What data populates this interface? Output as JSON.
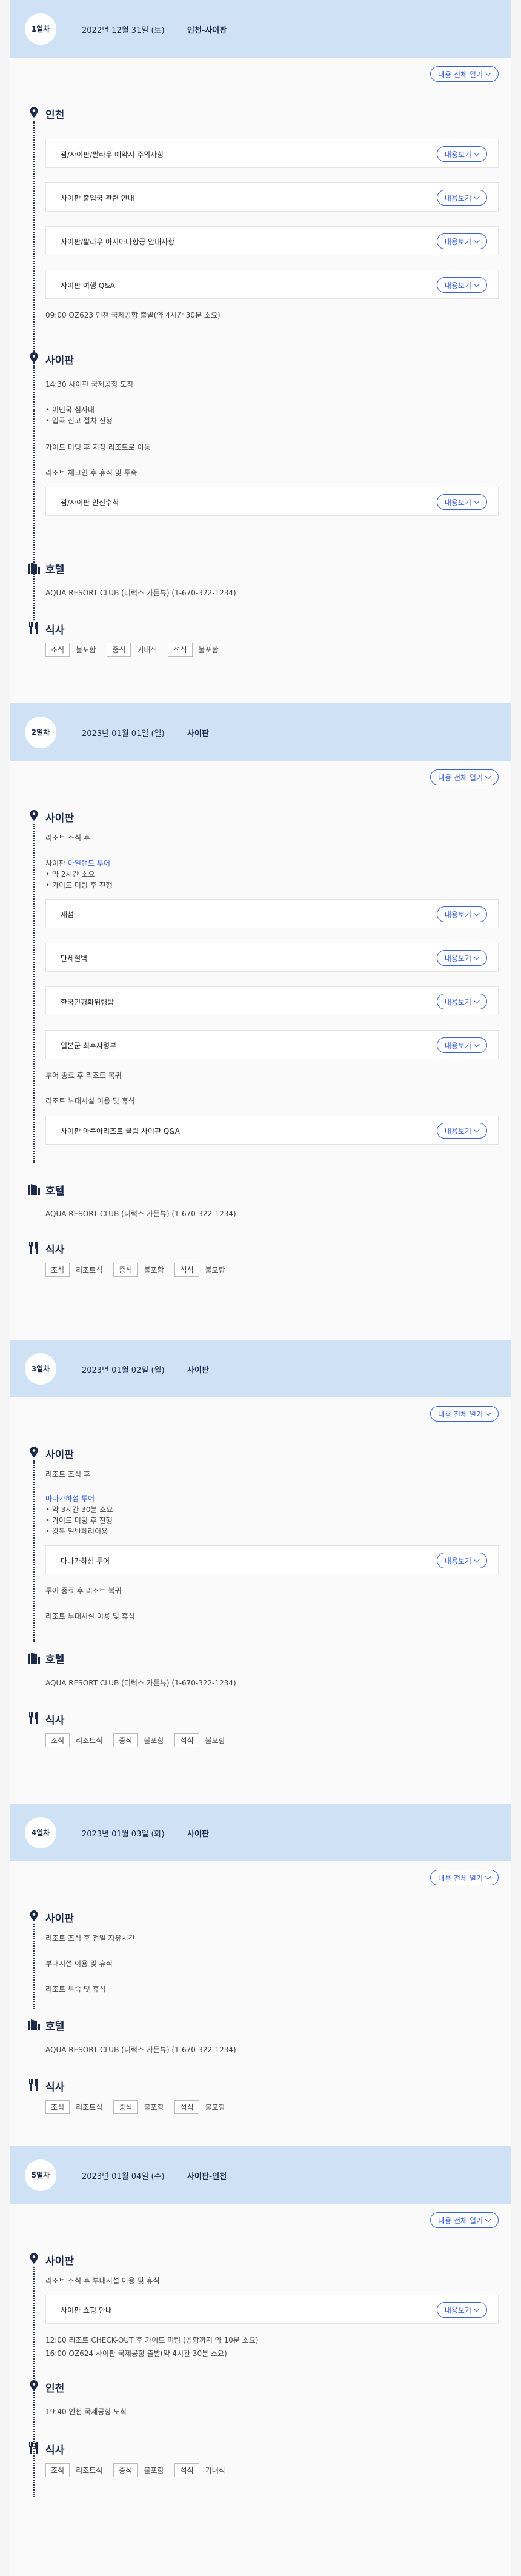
{
  "expand_all_label": "내용 전체 열기",
  "more_label": "내용보기",
  "hotel_label": "호텔",
  "meal_label": "식사",
  "meal_names": {
    "breakfast": "조식",
    "lunch": "중식",
    "dinner": "석식"
  },
  "days": [
    {
      "badge": "1일차",
      "date": "2022년 12월 31일 (토)",
      "route": "인천-사이판",
      "incheon": "인천",
      "cards1": [
        "괌/사이판/팔라우 예약시 주의사항",
        "사이판 출입국 관련 안내",
        "사이판/팔라우 아시아나항공 안내사항",
        "사이판 여행 Q&A"
      ],
      "depart": "09:00 OZ623 인천 국제공항 출발(약 4시간 30분 소요)",
      "saipan": "사이판",
      "arrive": "14:30 사이판 국제공항 도착",
      "immig1": "• 이민국 심사대",
      "immig2": "• 입국 신고 절차 진행",
      "guide": "가이드 미팅 후 지정 리조트로 이동",
      "checkin": "리조트 체크인 후 휴식 및 투숙",
      "safety": "괌/사이판 안전수칙",
      "hotel": "AQUA RESORT CLUB (디럭스 가든뷰) (1-670-322-1234)",
      "breakfast": "불포함",
      "lunch": "기내식",
      "dinner": "불포함"
    },
    {
      "badge": "2일차",
      "date": "2023년 01월 01일 (일)",
      "route": "사이판",
      "saipan": "사이판",
      "after_breakfast": "리조트 조식 후",
      "tour_prefix": "사이판 ",
      "tour_link": "아일랜드 투어",
      "tour1": "• 약 2시간 소요",
      "tour2": "• 가이드 미팅 후 진행",
      "cards": [
        "새섬",
        "만세절벽",
        "한국인평화위령탑",
        "일본군 최후사령부"
      ],
      "back": "투어 종료 후 리조트 복귀",
      "facilities": "리조트 부대시설 이용 및 휴식",
      "qa_card": "사이판 아쿠아리조트 클럽 사이판 Q&A",
      "hotel": "AQUA RESORT CLUB (디럭스 가든뷰) (1-670-322-1234)",
      "breakfast": "리조트식",
      "lunch": "불포함",
      "dinner": "불포함"
    },
    {
      "badge": "3일차",
      "date": "2023년 01월 02일 (월)",
      "route": "사이판",
      "saipan": "사이판",
      "after_breakfast": "리조트 조식 후",
      "tour_link": "마나가하섬 투어",
      "tour1": "• 약 3시간 30분 소요",
      "tour2": "• 가이드 미팅 후 진행",
      "tour3": "• 왕복 일반페리이용",
      "card": "마나가하섬 투어",
      "back": "투어 종료 후 리조트 복귀",
      "facilities": "리조트 부대시설 이용 및 휴식",
      "hotel": "AQUA RESORT CLUB (디럭스 가든뷰) (1-670-322-1234)",
      "breakfast": "리조트식",
      "lunch": "불포함",
      "dinner": "불포함"
    },
    {
      "badge": "4일차",
      "date": "2023년 01월 03일 (화)",
      "route": "사이판",
      "saipan": "사이판",
      "line1": "리조트 조식 후 전일 자유시간",
      "line2": "부대시설 이용 및 휴식",
      "line3": "리조트 투숙 및 휴식",
      "hotel": "AQUA RESORT CLUB (디럭스 가든뷰) (1-670-322-1234)",
      "breakfast": "리조트식",
      "lunch": "불포함",
      "dinner": "불포함"
    },
    {
      "badge": "5일차",
      "date": "2023년 01월 04일 (수)",
      "route": "사이판-인천",
      "saipan": "사이판",
      "line1": "리조트 조식 후 부대시설 이용 및 휴식",
      "card": "사이판 쇼핑 안내",
      "checkout": "12:00 리조트 CHECK-OUT 후 가이드 미팅 (공항까지 약 10분 소요)",
      "depart": "16:00 OZ624 사이판 국제공항 출발(약 4시간 30분 소요)",
      "incheon": "인천",
      "arrive": "19:40 인천 국제공항 도착",
      "breakfast": "리조트식",
      "lunch": "불포함",
      "dinner": "기내식"
    }
  ]
}
